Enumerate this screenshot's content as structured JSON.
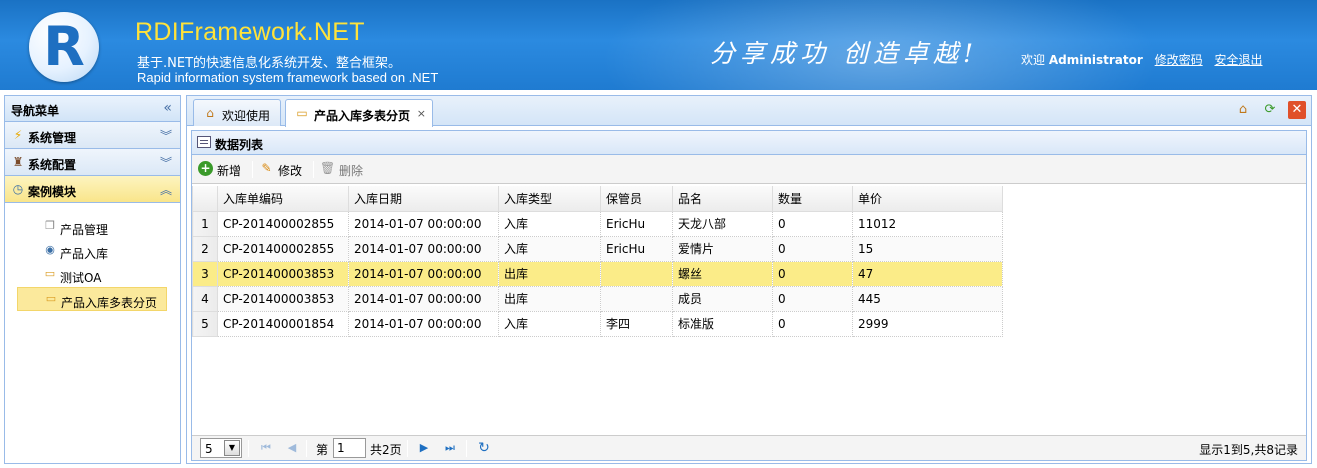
{
  "header": {
    "logo_letter": "R",
    "brand": "RDIFramework.NET",
    "subtitle_cn": "基于.NET的快速信息化系统开发、整合框架。",
    "subtitle_en": "Rapid information system framework based on .NET",
    "slogan": "分享成功  创造卓越!",
    "welcome": "欢迎",
    "username": "Administrator",
    "change_password": "修改密码",
    "logout": "安全退出"
  },
  "nav": {
    "title": "导航菜单",
    "sections": [
      {
        "label": "系统管理",
        "icon": "lightning-icon"
      },
      {
        "label": "系统配置",
        "icon": "config-icon"
      },
      {
        "label": "案例模块",
        "icon": "clock-icon"
      }
    ],
    "items": [
      {
        "label": "产品管理",
        "icon": "cube-icon"
      },
      {
        "label": "产品入库",
        "icon": "disc-icon"
      },
      {
        "label": "测试OA",
        "icon": "folder-icon"
      },
      {
        "label": "产品入库多表分页",
        "icon": "folder-icon"
      }
    ]
  },
  "tabs": [
    {
      "label": "欢迎使用",
      "icon": "home-icon"
    },
    {
      "label": "产品入库多表分页",
      "icon": "folder-icon"
    }
  ],
  "panel": {
    "title": "数据列表",
    "toolbar": {
      "add": "新增",
      "edit": "修改",
      "delete": "删除"
    }
  },
  "grid": {
    "columns": [
      "入库单编码",
      "入库日期",
      "入库类型",
      "保管员",
      "品名",
      "数量",
      "单价"
    ],
    "rows": [
      {
        "n": "1",
        "code": "CP-201400002855",
        "date": "2014-01-07 00:00:00",
        "type": "入库",
        "keeper": "EricHu",
        "name": "天龙八部",
        "qty": "0",
        "price": "11012"
      },
      {
        "n": "2",
        "code": "CP-201400002855",
        "date": "2014-01-07 00:00:00",
        "type": "入库",
        "keeper": "EricHu",
        "name": "爱情片",
        "qty": "0",
        "price": "15"
      },
      {
        "n": "3",
        "code": "CP-201400003853",
        "date": "2014-01-07 00:00:00",
        "type": "出库",
        "keeper": "",
        "name": "螺丝",
        "qty": "0",
        "price": "47"
      },
      {
        "n": "4",
        "code": "CP-201400003853",
        "date": "2014-01-07 00:00:00",
        "type": "出库",
        "keeper": "",
        "name": "成员",
        "qty": "0",
        "price": "445"
      },
      {
        "n": "5",
        "code": "CP-201400001854",
        "date": "2014-01-07 00:00:00",
        "type": "入库",
        "keeper": "李四",
        "name": "标准版",
        "qty": "0",
        "price": "2999"
      }
    ],
    "selected_row": 3
  },
  "pager": {
    "page_size": "5",
    "page_prefix": "第",
    "page_value": "1",
    "page_total": "共2页",
    "info": "显示1到5,共8记录"
  },
  "colors": {
    "header_blue": "#1f7bd1",
    "brand_yellow": "#ffe23a",
    "selected_row": "#fbec88",
    "border": "#99bbe8"
  }
}
